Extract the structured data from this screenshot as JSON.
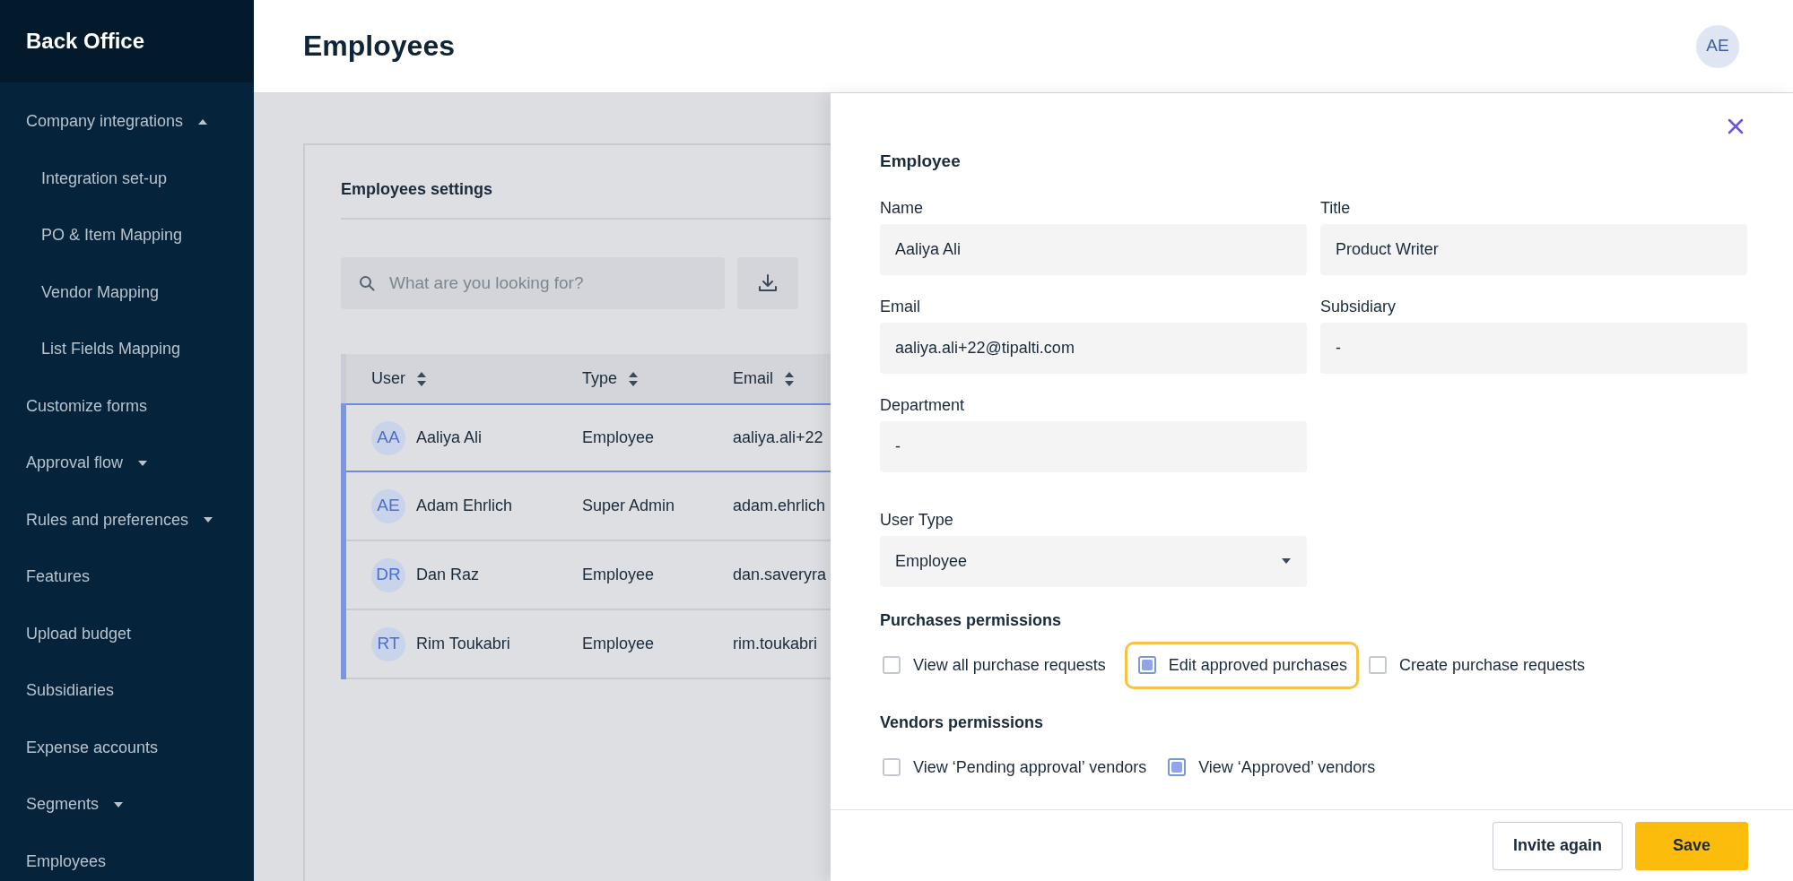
{
  "sidebar": {
    "brand": "Back Office",
    "items": [
      {
        "label": "Company integrations",
        "expanded": true,
        "children": [
          {
            "label": "Integration set-up"
          },
          {
            "label": "PO & Item Mapping"
          },
          {
            "label": "Vendor Mapping"
          },
          {
            "label": "List Fields Mapping"
          }
        ]
      },
      {
        "label": "Customize forms"
      },
      {
        "label": "Approval flow",
        "expanded": false
      },
      {
        "label": "Rules and preferences",
        "expanded": false
      },
      {
        "label": "Features"
      },
      {
        "label": "Upload budget"
      },
      {
        "label": "Subsidiaries"
      },
      {
        "label": "Expense accounts"
      },
      {
        "label": "Segments",
        "expanded": false
      },
      {
        "label": "Employees"
      }
    ]
  },
  "header": {
    "title": "Employees",
    "avatar": "AE"
  },
  "settings": {
    "title": "Employees settings",
    "search": {
      "placeholder": "What are you looking for?"
    },
    "table": {
      "columns": [
        "User",
        "Type",
        "Email"
      ],
      "rows": [
        {
          "initials": "AA",
          "user": "Aaliya Ali",
          "type": "Employee",
          "email": "aaliya.ali+22",
          "selected": true
        },
        {
          "initials": "AE",
          "user": "Adam Ehrlich",
          "type": "Super Admin",
          "email": "adam.ehrlich",
          "selected": false
        },
        {
          "initials": "DR",
          "user": "Dan Raz",
          "type": "Employee",
          "email": "dan.saveryra",
          "selected": false
        },
        {
          "initials": "RT",
          "user": "Rim Toukabri",
          "type": "Employee",
          "email": "rim.toukabri",
          "selected": false
        }
      ]
    }
  },
  "panel": {
    "title": "Employee",
    "fields": [
      {
        "label": "Name",
        "value": "Aaliya Ali",
        "kind": "text"
      },
      {
        "label": "Title",
        "value": "Product Writer",
        "kind": "text"
      },
      {
        "label": "Email",
        "value": "aaliya.ali+22@tipalti.com",
        "kind": "text"
      },
      {
        "label": "Subsidiary",
        "value": "-",
        "kind": "text"
      },
      {
        "label": "Department",
        "value": "-",
        "kind": "text"
      },
      {
        "label": "User Type",
        "value": "Employee",
        "kind": "select"
      }
    ],
    "permission_groups": [
      {
        "title": "Purchases permissions",
        "options": [
          {
            "label": "View all purchase requests",
            "checked": false,
            "highlighted": false
          },
          {
            "label": "Edit approved purchases",
            "checked": true,
            "highlighted": true
          },
          {
            "label": "Create purchase requests",
            "checked": false,
            "highlighted": false
          }
        ]
      },
      {
        "title": "Vendors permissions",
        "options": [
          {
            "label": "View ‘Pending approval’ vendors",
            "checked": false,
            "highlighted": false
          },
          {
            "label": "View ‘Approved’ vendors",
            "checked": true,
            "highlighted": false
          }
        ]
      }
    ],
    "buttons": [
      {
        "label": "Invite again",
        "kind": "secondary"
      },
      {
        "label": "Save",
        "kind": "primary"
      }
    ]
  }
}
